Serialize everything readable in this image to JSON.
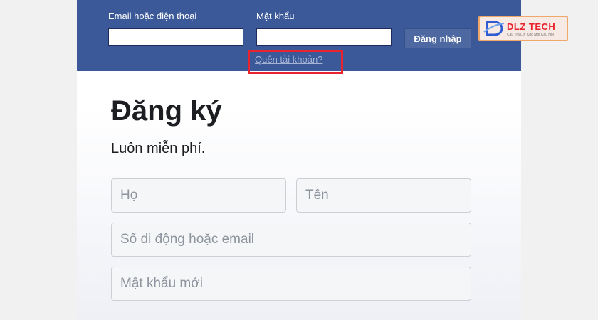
{
  "login": {
    "email_label": "Email hoặc điện thoại",
    "password_label": "Mật khẩu",
    "login_button": "Đăng nhập",
    "forgot_link": "Quên tài khoản?"
  },
  "signup": {
    "title": "Đăng ký",
    "subtitle": "Luôn miễn phí.",
    "last_name_placeholder": "Họ",
    "first_name_placeholder": "Tên",
    "contact_placeholder": "Số di động hoặc email",
    "new_password_placeholder": "Mật khẩu mới"
  },
  "watermark": {
    "brand": "DLZ TECH",
    "tagline": "Câu Trả Lời Cho Mọi Câu Hỏi"
  },
  "colors": {
    "header_bg": "#3b5998",
    "login_button_bg": "#4e69a2",
    "highlight_border": "#e8242e"
  }
}
